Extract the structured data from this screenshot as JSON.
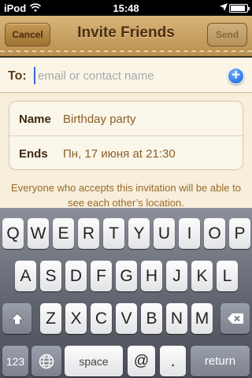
{
  "status_bar": {
    "carrier": "iPod",
    "time": "15:48",
    "battery_level_percent": 90
  },
  "nav": {
    "title": "Invite Friends",
    "cancel_label": "Cancel",
    "send_label": "Send"
  },
  "to_field": {
    "label": "To:",
    "placeholder": "email or contact name",
    "value": ""
  },
  "event": {
    "name_label": "Name",
    "name_value": "Birthday party",
    "ends_label": "Ends",
    "ends_value": "Пн, 17 июня at 21:30"
  },
  "notice": "Everyone who accepts this invitation will be able to see each other’s location.",
  "keyboard": {
    "row1": [
      "Q",
      "W",
      "E",
      "R",
      "T",
      "Y",
      "U",
      "I",
      "O",
      "P"
    ],
    "row2": [
      "A",
      "S",
      "D",
      "F",
      "G",
      "H",
      "J",
      "K",
      "L"
    ],
    "row3": [
      "Z",
      "X",
      "C",
      "V",
      "B",
      "N",
      "M"
    ],
    "numbers_label": "123",
    "space_label": "space",
    "at_label": "@",
    "dot_label": ".",
    "return_label": "return"
  },
  "colors": {
    "leather": "#c7a164",
    "accent_blue": "#1a5fd6",
    "parchment": "#f7eedb"
  }
}
